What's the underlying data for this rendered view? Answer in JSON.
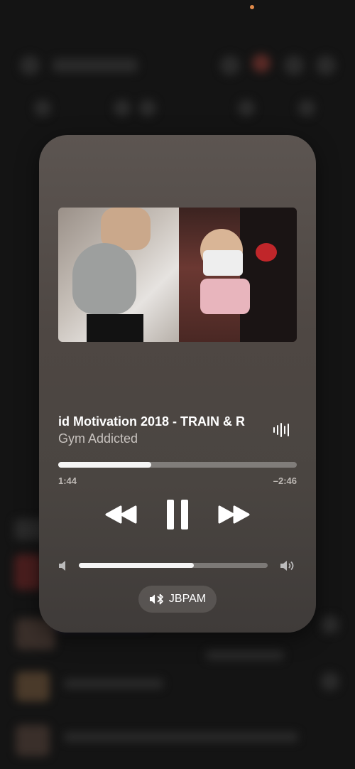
{
  "now_playing": {
    "title": "id Motivation 2018 - TRAIN & R",
    "artist": "Gym Addicted",
    "progress_fraction": 0.39,
    "elapsed": "1:44",
    "remaining": "–2:46"
  },
  "volume": {
    "level_fraction": 0.61
  },
  "output_device": {
    "name": "JBPAM"
  },
  "icons": {
    "waveform": "waveform-icon",
    "rewind": "rewind-icon",
    "pause": "pause-icon",
    "fast_forward": "fast-forward-icon",
    "volume_low": "speaker-low-icon",
    "volume_high": "speaker-high-icon",
    "output": "speaker-bluetooth-icon"
  },
  "colors": {
    "accent_status_dot": "#e08a4a",
    "card_background": "#4e4743",
    "text_primary": "#ffffff",
    "text_secondary": "#c8c3bf"
  }
}
